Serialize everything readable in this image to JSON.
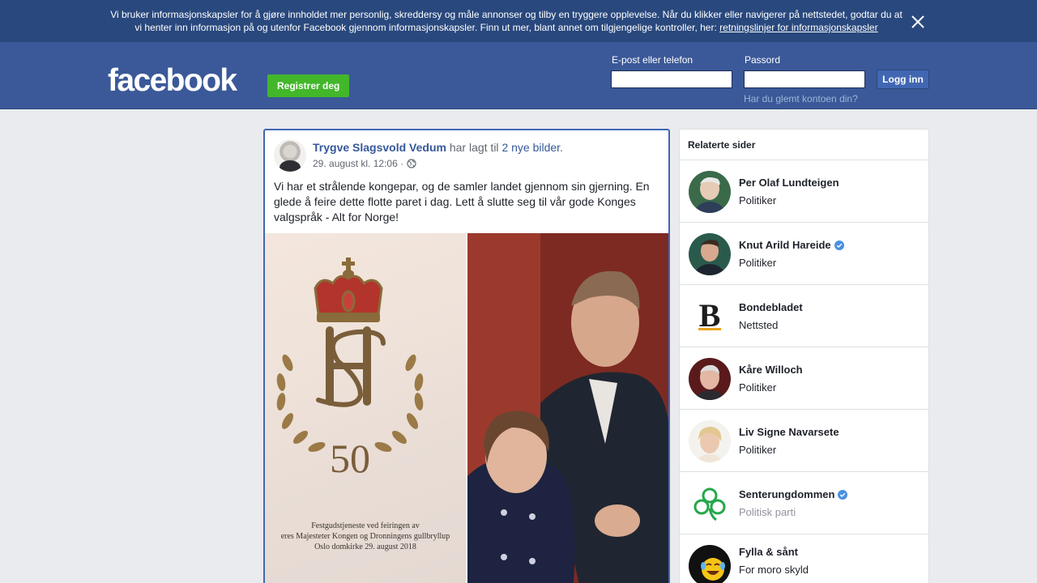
{
  "cookie_banner": {
    "text_line1": "Vi bruker informasjonskapsler for å gjøre innholdet mer personlig, skreddersy og måle annonser og tilby en tryggere opplevelse. Når du klikker eller navigerer på nettstedet, godtar du at",
    "text_line2": "vi henter inn informasjon på og utenfor Facebook gjennom informasjonskapsler. Finn ut mer, blant annet om tilgjengelige kontroller, her: ",
    "link": "retningslinjer for informasjonskapsler",
    "close_icon": "close-icon"
  },
  "header": {
    "logo": "facebook",
    "register_label": "Registrer deg",
    "email_label": "E-post eller telefon",
    "email_value": "",
    "password_label": "Passord",
    "password_value": "",
    "login_label": "Logg inn",
    "forgot_label": "Har du glemt kontoen din?"
  },
  "post": {
    "author": "Trygve Slagsvold Vedum",
    "action": " har lagt til ",
    "action_link": "2 nye bilder",
    "action_end": ".",
    "time": "29. august kl. 12:06 ·",
    "privacy_icon": "globe-icon",
    "text": "Vi har et strålende kongepar, og de samler landet gjennom sin gjerning. En glede å feire dette flotte paret i dag. Lett å slutte seg til vår gode Konges valgspråk - Alt for Norge!",
    "photo_left": {
      "monogram": "HS",
      "number": "50",
      "caption_line1": "Festgudstjeneste ved feiringen av",
      "caption_line2": "eres Majesteter Kongen og Dronningens gullbryllup",
      "caption_line3": "Oslo domkirke 29. august 2018"
    }
  },
  "sidebar": {
    "title": "Relaterte sider",
    "items": [
      {
        "name": "Per Olaf Lundteigen",
        "category": "Politiker",
        "verified": false
      },
      {
        "name": "Knut Arild Hareide",
        "category": "Politiker",
        "verified": true
      },
      {
        "name": "Bondebladet",
        "category": "Nettsted",
        "verified": false,
        "logo_letter": "B"
      },
      {
        "name": "Kåre Willoch",
        "category": "Politiker",
        "verified": false
      },
      {
        "name": "Liv Signe Navarsete",
        "category": "Politiker",
        "verified": false
      },
      {
        "name": "Senterungdommen",
        "category": "Politisk parti",
        "verified": true
      },
      {
        "name": "Fylla & sånt",
        "category": "For moro skyld",
        "verified": false
      }
    ]
  },
  "colors": {
    "brand_blue": "#3b5998",
    "banner_blue": "#29487d",
    "register_green": "#42b72a",
    "link_blue": "#365899",
    "verified_blue": "#4a90e2"
  }
}
